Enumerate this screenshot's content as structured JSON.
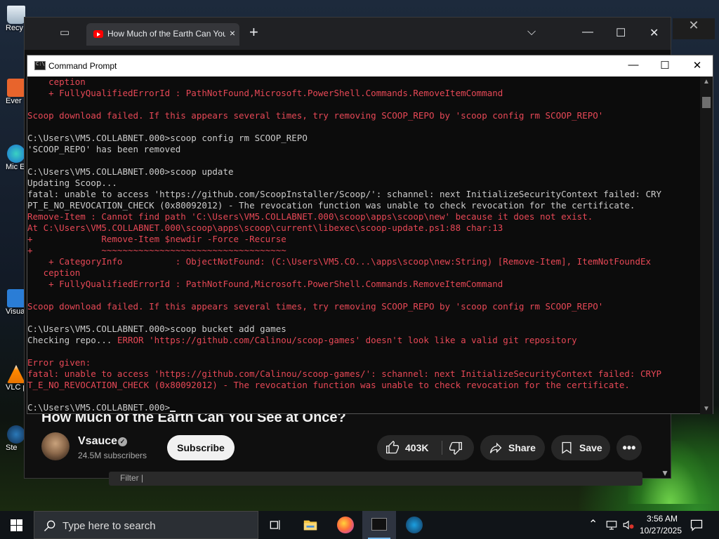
{
  "desktop": {
    "icons": [
      {
        "label": "Recy"
      },
      {
        "label": "Ever"
      },
      {
        "label": "Mic E"
      },
      {
        "label": "Visua C"
      },
      {
        "label": "VLC pl"
      },
      {
        "label": "Ste"
      }
    ]
  },
  "browser": {
    "tab_title": "How Much of the Earth Can You",
    "tab_close": "×",
    "new_tab": "+",
    "controls": {
      "dropdown": "⌵",
      "minimize": "—",
      "maximize": "☐",
      "close": "✕"
    },
    "outer_close": "✕",
    "video_title": "How Much of the Earth Can You See at Once?",
    "channel": {
      "name": "Vsauce",
      "subscribers": "24.5M subscribers",
      "verified_mark": "✓"
    },
    "subscribe_label": "Subscribe",
    "like_count": "403K",
    "share_label": "Share",
    "save_label": "Save",
    "more_label": "•••",
    "filter_text": "Filter |"
  },
  "cmd": {
    "title": "Command Prompt",
    "icon_text": "C:\\",
    "controls": {
      "minimize": "—",
      "maximize": "☐",
      "close": "✕"
    },
    "lines": [
      {
        "text": "    ception",
        "red": true
      },
      {
        "text": "    + FullyQualifiedErrorId : PathNotFound,Microsoft.PowerShell.Commands.RemoveItemCommand",
        "red": true
      },
      {
        "text": "",
        "red": false
      },
      {
        "text": "Scoop download failed. If this appears several times, try removing SCOOP_REPO by 'scoop config rm SCOOP_REPO'",
        "red": true
      },
      {
        "text": "",
        "red": false
      },
      {
        "text": "C:\\Users\\VM5.COLLABNET.000>scoop config rm SCOOP_REPO",
        "red": false
      },
      {
        "text": "'SCOOP_REPO' has been removed",
        "red": false
      },
      {
        "text": "",
        "red": false
      },
      {
        "text": "C:\\Users\\VM5.COLLABNET.000>scoop update",
        "red": false
      },
      {
        "text": "Updating Scoop...",
        "red": false
      },
      {
        "text": "fatal: unable to access 'https://github.com/ScoopInstaller/Scoop/': schannel: next InitializeSecurityContext failed: CRY",
        "red": false
      },
      {
        "text": "PT_E_NO_REVOCATION_CHECK (0x80092012) - The revocation function was unable to check revocation for the certificate.",
        "red": false
      },
      {
        "text": "Remove-Item : Cannot find path 'C:\\Users\\VM5.COLLABNET.000\\scoop\\apps\\scoop\\new' because it does not exist.",
        "red": true
      },
      {
        "text": "At C:\\Users\\VM5.COLLABNET.000\\scoop\\apps\\scoop\\current\\libexec\\scoop-update.ps1:88 char:13",
        "red": true
      },
      {
        "text": "+             Remove-Item $newdir -Force -Recurse",
        "red": true
      },
      {
        "text": "+             ~~~~~~~~~~~~~~~~~~~~~~~~~~~~~~~~~~~",
        "red": true
      },
      {
        "text": "    + CategoryInfo          : ObjectNotFound: (C:\\Users\\VM5.CO...\\apps\\scoop\\new:String) [Remove-Item], ItemNotFoundEx",
        "red": true
      },
      {
        "text": "   ception",
        "red": true
      },
      {
        "text": "    + FullyQualifiedErrorId : PathNotFound,Microsoft.PowerShell.Commands.RemoveItemCommand",
        "red": true
      },
      {
        "text": "",
        "red": false
      },
      {
        "text": "Scoop download failed. If this appears several times, try removing SCOOP_REPO by 'scoop config rm SCOOP_REPO'",
        "red": true
      },
      {
        "text": "",
        "red": false
      },
      {
        "text": "C:\\Users\\VM5.COLLABNET.000>scoop bucket add games",
        "red": false
      },
      {
        "text": "Checking repo... ",
        "red": false,
        "suffix": "ERROR 'https://github.com/Calinou/scoop-games' doesn't look like a valid git repository"
      },
      {
        "text": "",
        "red": false
      },
      {
        "text": "Error given:",
        "red": true
      },
      {
        "text": "fatal: unable to access 'https://github.com/Calinou/scoop-games/': schannel: next InitializeSecurityContext failed: CRYP",
        "red": true
      },
      {
        "text": "T_E_NO_REVOCATION_CHECK (0x80092012) - The revocation function was unable to check revocation for the certificate.",
        "red": true
      },
      {
        "text": "",
        "red": false
      },
      {
        "text": "C:\\Users\\VM5.COLLABNET.000>",
        "red": false,
        "cursor": true
      }
    ],
    "scroll_up": "▲",
    "scroll_down": "▼"
  },
  "taskbar": {
    "search_placeholder": "Type here to search",
    "time": "3:56 AM",
    "date": "10/27/2025",
    "tray_chevron": "⌃"
  },
  "colors": {
    "error_red": "#e74856",
    "console_gray": "#cccccc",
    "console_bg": "#0c0c0c"
  }
}
